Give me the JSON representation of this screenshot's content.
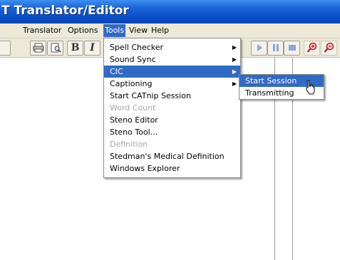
{
  "window": {
    "title": "T Translator/Editor"
  },
  "menubar": {
    "items": [
      {
        "label": "Translator",
        "name": "menu-translator"
      },
      {
        "label": "Options",
        "name": "menu-options"
      },
      {
        "label": "Tools",
        "name": "menu-tools",
        "active": true
      },
      {
        "label": "View",
        "name": "menu-view"
      },
      {
        "label": "Help",
        "name": "menu-help"
      }
    ]
  },
  "toolbar": {
    "bold_label": "B",
    "italic_label": "I",
    "icons": [
      "print-icon",
      "print-preview-icon",
      "play-icon",
      "pause-icon",
      "stop-icon",
      "zoom-in-icon",
      "zoom-out-icon"
    ]
  },
  "tools_menu": {
    "items": [
      {
        "label": "Spell Checker",
        "submenu": true
      },
      {
        "label": "Sound Sync",
        "submenu": true
      },
      {
        "label": "CIC",
        "submenu": true,
        "highlighted": true
      },
      {
        "label": "Captioning",
        "submenu": true
      },
      {
        "label": "Start CATnip Session"
      },
      {
        "label": "Word Count",
        "disabled": true
      },
      {
        "label": "Steno Editor"
      },
      {
        "label": "Steno Tool..."
      },
      {
        "label": "Definition",
        "disabled": true
      },
      {
        "label": "Stedman's Medical Definition"
      },
      {
        "label": "Windows Explorer"
      }
    ]
  },
  "cic_submenu": {
    "items": [
      {
        "label": "Start Session",
        "highlighted": true
      },
      {
        "label": "Transmitting"
      }
    ]
  },
  "colors": {
    "titlebar": "#0b4fc9",
    "menu_highlight": "#316ac5",
    "menubar_bg": "#ece9d8"
  }
}
